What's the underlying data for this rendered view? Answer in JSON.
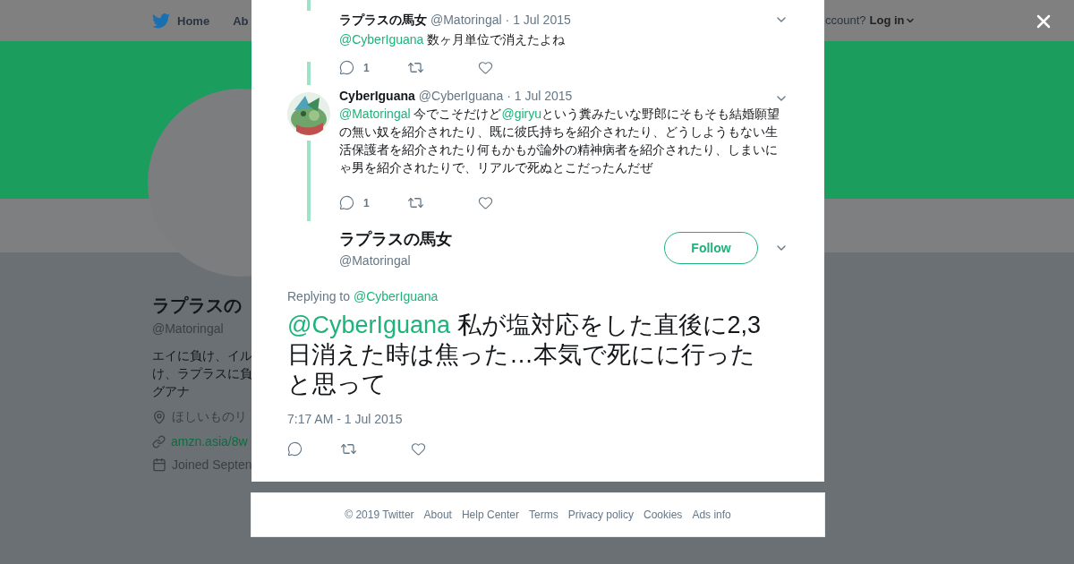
{
  "background_page": {
    "nav": [
      {
        "label": "Home"
      },
      {
        "label": "Ab"
      }
    ],
    "login_prompt": "ccount?",
    "login": "Log in",
    "profile": {
      "name": "ラプラスの",
      "handle": "@Matoringal",
      "bio": [
        "エイに負け、イル",
        "け、ラプラスに負",
        "グアナ"
      ],
      "location": "ほしいものリ",
      "link": "amzn.asia/8w",
      "joined": "Joined Septen"
    }
  },
  "thread": [
    {
      "avatar": false,
      "name": "ラプラスの馬女",
      "handle": "@Matoringal",
      "date": "· 1 Jul 2015",
      "body": [
        {
          "kind": "mention",
          "text": "@CyberIguana"
        },
        {
          "kind": "plain",
          "text": " 数ヶ月単位で消えたよね"
        }
      ],
      "reply_count": "1"
    },
    {
      "avatar": true,
      "name": "CyberIguana",
      "handle": "@CyberIguana",
      "date": "· 1 Jul 2015",
      "body": [
        {
          "kind": "mention",
          "text": "@Matoringal"
        },
        {
          "kind": "plain",
          "text": " 今でこそだけど"
        },
        {
          "kind": "mention",
          "text": "@giryu"
        },
        {
          "kind": "plain",
          "text": "という糞みたいな野郎にそもそも結婚願望の無い奴を紹介されたり、既に彼氏持ちを紹介されたり、どうしようもない生活保護者を紹介されたり何もかもが論外の精神病者を紹介されたり、しまいにゃ男を紹介されたりで、リアルで死ぬとこだったんだぜ"
        }
      ],
      "reply_count": "1"
    }
  ],
  "main_tweet": {
    "name": "ラプラスの馬女",
    "handle": "@Matoringal",
    "follow": "Follow",
    "replying_prefix": "Replying to",
    "replying_to": "@CyberIguana",
    "body": [
      {
        "kind": "mention",
        "text": "@CyberIguana"
      },
      {
        "kind": "plain",
        "text": " 私が塩対応をした直後に2,3日消えた時は焦った…本気で死にに行ったと思って"
      }
    ],
    "time": "7:17 AM - 1 Jul 2015"
  },
  "footer": [
    "© 2019 Twitter",
    "About",
    "Help Center",
    "Terms",
    "Privacy policy",
    "Cookies",
    "Ads info"
  ]
}
